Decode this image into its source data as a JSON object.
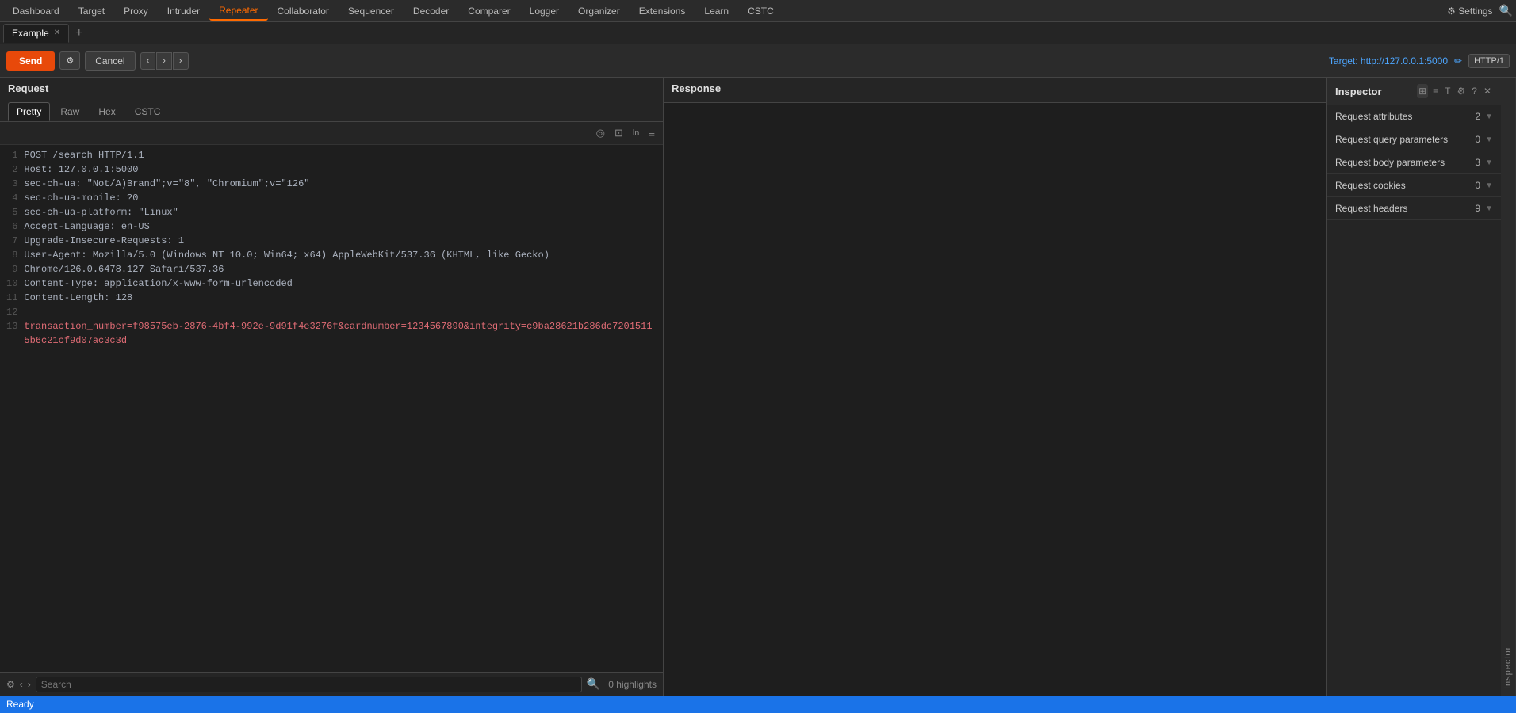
{
  "nav": {
    "items": [
      {
        "label": "Dashboard",
        "active": false
      },
      {
        "label": "Target",
        "active": false
      },
      {
        "label": "Proxy",
        "active": false
      },
      {
        "label": "Intruder",
        "active": false
      },
      {
        "label": "Repeater",
        "active": true
      },
      {
        "label": "Collaborator",
        "active": false
      },
      {
        "label": "Sequencer",
        "active": false
      },
      {
        "label": "Decoder",
        "active": false
      },
      {
        "label": "Comparer",
        "active": false
      },
      {
        "label": "Logger",
        "active": false
      },
      {
        "label": "Organizer",
        "active": false
      },
      {
        "label": "Extensions",
        "active": false
      },
      {
        "label": "Learn",
        "active": false
      },
      {
        "label": "CSTC",
        "active": false
      }
    ],
    "settings_label": "⚙ Settings"
  },
  "tabs": {
    "items": [
      {
        "label": "Example",
        "active": true
      }
    ],
    "new_tab_icon": "+"
  },
  "toolbar": {
    "send_label": "Send",
    "cancel_label": "Cancel",
    "target_label": "Target: http://127.0.0.1:5000",
    "http_version": "HTTP/1",
    "prev_arrow": "‹",
    "next_arrow": "›",
    "extra_arrow": "›"
  },
  "request_panel": {
    "title": "Request",
    "tabs": [
      "Pretty",
      "Raw",
      "Hex",
      "CSTC"
    ],
    "active_tab": "Pretty",
    "lines": [
      {
        "num": 1,
        "text": "POST /search HTTP/1.1",
        "style": "normal"
      },
      {
        "num": 2,
        "text": "Host: 127.0.0.1:5000",
        "style": "normal"
      },
      {
        "num": 3,
        "text": "sec-ch-ua: \"Not/A)Brand\";v=\"8\", \"Chromium\";v=\"126\"",
        "style": "normal"
      },
      {
        "num": 4,
        "text": "sec-ch-ua-mobile: ?0",
        "style": "normal"
      },
      {
        "num": 5,
        "text": "sec-ch-ua-platform: \"Linux\"",
        "style": "normal"
      },
      {
        "num": 6,
        "text": "Accept-Language: en-US",
        "style": "normal"
      },
      {
        "num": 7,
        "text": "Upgrade-Insecure-Requests: 1",
        "style": "normal"
      },
      {
        "num": 8,
        "text": "User-Agent: Mozilla/5.0 (Windows NT 10.0; Win64; x64) AppleWebKit/537.36 (KHTML, like Gecko)",
        "style": "normal"
      },
      {
        "num": 9,
        "text": "Chrome/126.0.6478.127 Safari/537.36",
        "style": "normal"
      },
      {
        "num": 10,
        "text": "Content-Type: application/x-www-form-urlencoded",
        "style": "normal"
      },
      {
        "num": 11,
        "text": "Content-Length: 128",
        "style": "normal"
      },
      {
        "num": 12,
        "text": "",
        "style": "normal"
      },
      {
        "num": 13,
        "text": "transaction_number=f98575eb-2876-4bf4-992e-9d91f4e3276f&cardnumber=1234567890&integrity=c9ba28621b286dc72015115b6c21cf9d07ac3c3d",
        "style": "red"
      }
    ],
    "search_placeholder": "Search",
    "highlights": "0 highlights"
  },
  "response_panel": {
    "title": "Response"
  },
  "inspector": {
    "title": "Inspector",
    "sections": [
      {
        "label": "Request attributes",
        "count": 2
      },
      {
        "label": "Request query parameters",
        "count": 0
      },
      {
        "label": "Request body parameters",
        "count": 3
      },
      {
        "label": "Request cookies",
        "count": 0
      },
      {
        "label": "Request headers",
        "count": 9
      }
    ],
    "side_label": "Inspector"
  },
  "status_bar": {
    "text": "Ready"
  }
}
